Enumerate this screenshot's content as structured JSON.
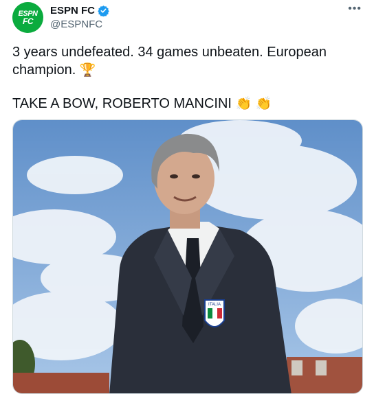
{
  "account": {
    "display_name": "ESPN FC",
    "handle": "@ESPNFC",
    "avatar_logo_text_top": "ESPN",
    "avatar_logo_text_bottom": "FC",
    "avatar_color": "#0bab3e",
    "verified_icon": "verified-badge-icon",
    "verified_color": "#1d9bf0"
  },
  "menu": {
    "more_label": "•••"
  },
  "tweet": {
    "line1": "3 years undefeated. 34 games unbeaten. European champion.",
    "line1_emoji": "🏆",
    "line2": "TAKE A BOW, ROBERTO MANCINI",
    "line2_emoji_1": "👏",
    "line2_emoji_2": "👏"
  },
  "media": {
    "photo_icon": "photo-portrait",
    "crest_text": "ITALIA"
  }
}
